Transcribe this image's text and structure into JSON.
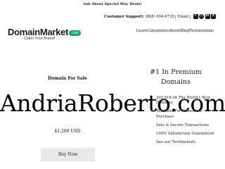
{
  "promo": "Ask About Special May Deals!",
  "support": {
    "label": "Customer Support:",
    "phone": "(888) 694-6735",
    "separator": "|",
    "email_label": "Email |"
  },
  "social": [
    {
      "name": "facebook-icon",
      "glyph": "f"
    },
    {
      "name": "instagram-icon",
      "glyph": "◎"
    },
    {
      "name": "linkedin-icon",
      "glyph": "in"
    },
    {
      "name": "x-icon",
      "glyph": "X"
    }
  ],
  "logo": {
    "main": "DomainMarket",
    "badge": ".com",
    "tagline": "Claim Your Brand!"
  },
  "nav": [
    "Learn",
    "Categories",
    "About",
    "Blog",
    "Testimonials"
  ],
  "listing": {
    "title": "Domain For Sale",
    "domain": "AndriaRoberto.com",
    "price": "$1,288 USD",
    "buy_label": "Buy Now"
  },
  "premium_heading": "#1 In Premium Domains",
  "features": [
    "203,818 Of The World's Best Domains",
    "Available For Immediate Purchase",
    "Safe & Secure Transactions",
    "100% Satisfaction Guaranteed",
    "See our Testimonials"
  ],
  "colors": {
    "brand_badge": "#1aa36a",
    "button_bg": "#e9e9e9"
  }
}
